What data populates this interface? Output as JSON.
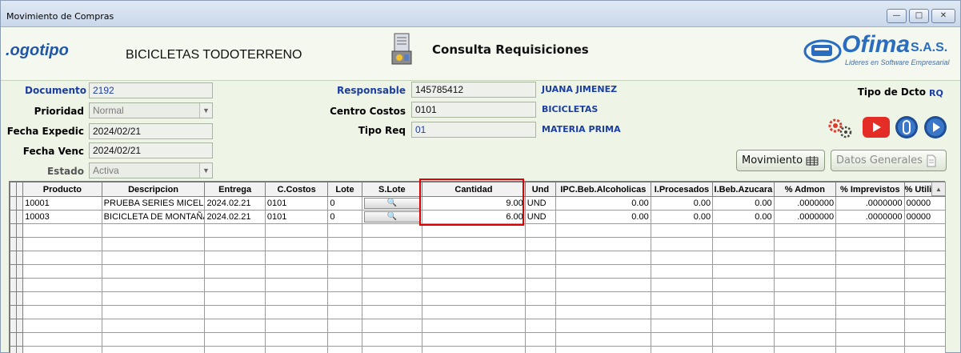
{
  "window": {
    "title": "Movimiento de Compras",
    "buttons": [
      "minimize",
      "maximize",
      "close"
    ]
  },
  "header": {
    "logo_text": ".ogotipo",
    "company": "BICICLETAS TODOTERRENO",
    "module_title": "Consulta Requisiciones",
    "brand_name": "Ofima",
    "brand_suffix": "S.A.S.",
    "brand_tagline": "Lideres en Software Empresarial"
  },
  "form": {
    "documento_label": "Documento",
    "documento": "2192",
    "prioridad_label": "Prioridad",
    "prioridad": "Normal",
    "fecha_expedic_label": "Fecha Expedic",
    "fecha_expedic": "2024/02/21",
    "fecha_venc_label": "Fecha Venc",
    "fecha_venc": "2024/02/21",
    "estado_label": "Estado",
    "estado": "Activa",
    "responsable_label": "Responsable",
    "responsable": "145785412",
    "responsable_name": "JUANA JIMENEZ",
    "centro_costos_label": "Centro Costos",
    "centro_costos": "0101",
    "centro_costos_name": "BICICLETAS",
    "tipo_req_label": "Tipo Req",
    "tipo_req": "01",
    "tipo_req_name": "MATERIA PRIMA",
    "tipo_dcto_label": "Tipo de Dcto",
    "tipo_dcto": "RQ"
  },
  "buttons": {
    "movimiento": "Movimiento",
    "datos_generales": "Datos Generales"
  },
  "icons": {
    "settings": "gears-icon",
    "youtube": "youtube-icon",
    "attach": "paperclip-icon",
    "next": "play-circle-icon"
  },
  "table": {
    "columns": [
      "Producto",
      "Descripcion",
      "Entrega",
      "C.Costos",
      "Lote",
      "S.Lote",
      "Cantidad",
      "Und",
      "IPC.Beb.Alcoholicas",
      "I.Procesados",
      "I.Beb.Azucara",
      "% Admon",
      "% Imprevistos",
      "% Utilid"
    ],
    "rows": [
      [
        "10001",
        "PRUEBA SERIES MICELU",
        "2024.02.21",
        "0101",
        "0",
        "",
        "9.00",
        "UND",
        "0.00",
        "0.00",
        "0.00",
        ".0000000",
        ".0000000",
        "00000"
      ],
      [
        "10003",
        "BICICLETA DE MONTAÑA",
        "2024.02.21",
        "0101",
        "0",
        "",
        "6.00",
        "UND",
        "0.00",
        "0.00",
        "0.00",
        ".0000000",
        ".0000000",
        "00000"
      ]
    ],
    "empty_rows": 10
  },
  "colors": {
    "accent": "#1c3ea3",
    "highlight": "#e00000",
    "background": "#eef5e6"
  }
}
